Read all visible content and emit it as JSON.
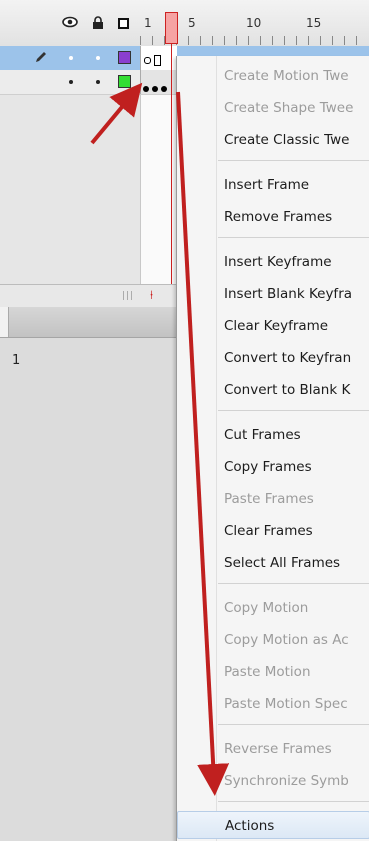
{
  "timeline": {
    "ruler_numbers": [
      "1",
      "5",
      "10",
      "15"
    ],
    "layer_panel_value": "1"
  },
  "context_menu": {
    "items": [
      {
        "label": "Create Motion Twe",
        "enabled": false
      },
      {
        "label": "Create Shape Twee",
        "enabled": false
      },
      {
        "label": "Create Classic Twe",
        "enabled": true
      },
      {
        "label": "Insert Frame",
        "enabled": true
      },
      {
        "label": "Remove Frames",
        "enabled": true
      },
      {
        "label": "Insert Keyframe",
        "enabled": true
      },
      {
        "label": "Insert Blank Keyfra",
        "enabled": true
      },
      {
        "label": "Clear Keyframe",
        "enabled": true
      },
      {
        "label": "Convert to Keyfran",
        "enabled": true
      },
      {
        "label": "Convert to Blank K",
        "enabled": true
      },
      {
        "label": "Cut Frames",
        "enabled": true
      },
      {
        "label": "Copy Frames",
        "enabled": true
      },
      {
        "label": "Paste Frames",
        "enabled": false
      },
      {
        "label": "Clear Frames",
        "enabled": true
      },
      {
        "label": "Select All Frames",
        "enabled": true
      },
      {
        "label": "Copy Motion",
        "enabled": false
      },
      {
        "label": "Copy Motion as Ac",
        "enabled": false
      },
      {
        "label": "Paste Motion",
        "enabled": false
      },
      {
        "label": "Paste Motion Spec",
        "enabled": false
      },
      {
        "label": "Reverse Frames",
        "enabled": false
      },
      {
        "label": "Synchronize Symb",
        "enabled": false
      },
      {
        "label": "Actions",
        "enabled": true,
        "highlighted": true
      }
    ]
  },
  "colors": {
    "annotation_arrow": "#c0201f",
    "selected_layer_bg": "#9cc3ea",
    "layer1_swatch": "#8a3fcf",
    "layer2_swatch": "#33dd33",
    "playhead": "#cc2222"
  },
  "icons": [
    "eye-icon",
    "lock-icon",
    "outline-square-icon",
    "pencil-icon"
  ]
}
